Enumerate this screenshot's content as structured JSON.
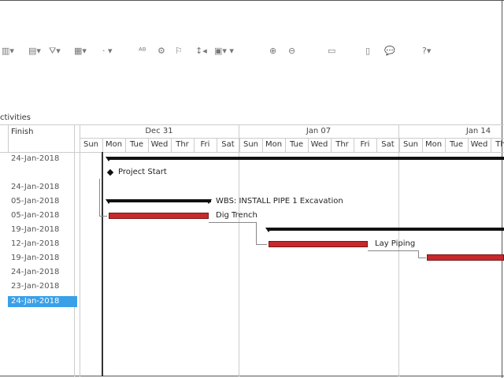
{
  "toolbar": {
    "icons": [
      "columns-icon",
      "filter-icon",
      "layout-icon",
      "bars-icon",
      "spell-check-icon",
      "settings-icon",
      "flag-icon",
      "format-icon",
      "chart-icon",
      "zoom-in-icon",
      "zoom-out-icon",
      "split-icon",
      "notebook-icon",
      "comment-icon",
      "help-icon"
    ]
  },
  "panel": {
    "activities_label": "ctivities",
    "finish_header": "Finish"
  },
  "finish_values": [
    "24-Jan-2018",
    "24-Jan-2018",
    "05-Jan-2018",
    "05-Jan-2018",
    "19-Jan-2018",
    "12-Jan-2018",
    "19-Jan-2018",
    "24-Jan-2018",
    "23-Jan-2018",
    "24-Jan-2018"
  ],
  "timeline": {
    "weeks": [
      "Dec 31",
      "Jan 07",
      "Jan 14"
    ],
    "days": [
      "Sun",
      "Mon",
      "Tue",
      "Wed",
      "Thr",
      "Fri",
      "Sat",
      "Sun",
      "Mon",
      "Tue",
      "Wed",
      "Thr",
      "Fri",
      "Sat",
      "Sun",
      "Mon",
      "Tue",
      "Wed",
      "Thr"
    ]
  },
  "gantt": {
    "project_start": "Project Start",
    "wbs_label": "WBS: INSTALL PIPE 1  Excavation",
    "dig_trench": "Dig Trench",
    "lay_piping": "Lay Piping"
  }
}
